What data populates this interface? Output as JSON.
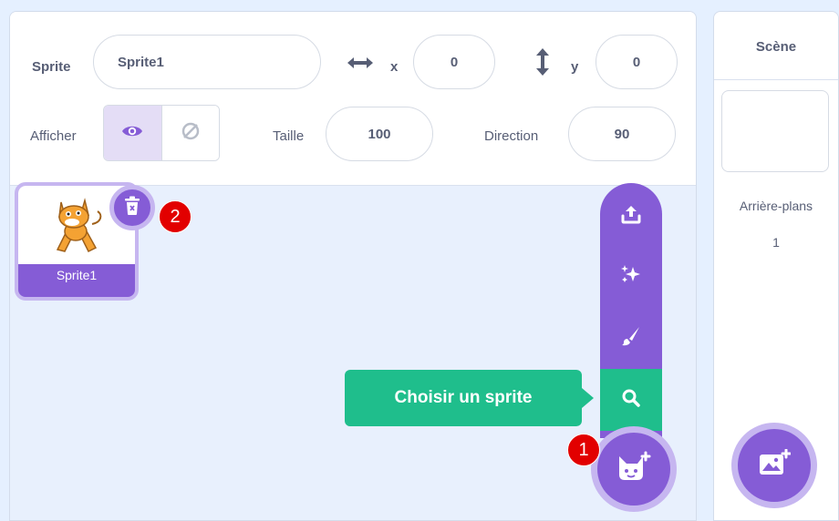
{
  "sprite_info": {
    "sprite_label": "Sprite",
    "sprite_name": "Sprite1",
    "x_label": "x",
    "x_value": "0",
    "y_label": "y",
    "y_value": "0",
    "show_label": "Afficher",
    "size_label": "Taille",
    "size_value": "100",
    "direction_label": "Direction",
    "direction_value": "90"
  },
  "sprite_list": {
    "items": [
      {
        "name": "Sprite1"
      }
    ]
  },
  "add_menu": {
    "tooltip": "Choisir un sprite"
  },
  "badges": {
    "one": "1",
    "two": "2"
  },
  "stage": {
    "title": "Scène",
    "backdrops_label": "Arrière-plans",
    "backdrops_count": "1"
  },
  "colors": {
    "accent": "#855cd6",
    "accent_light": "#c6b6f0",
    "extension_green": "#1fbe8c",
    "badge_red": "#e20000",
    "text": "#575e75"
  }
}
